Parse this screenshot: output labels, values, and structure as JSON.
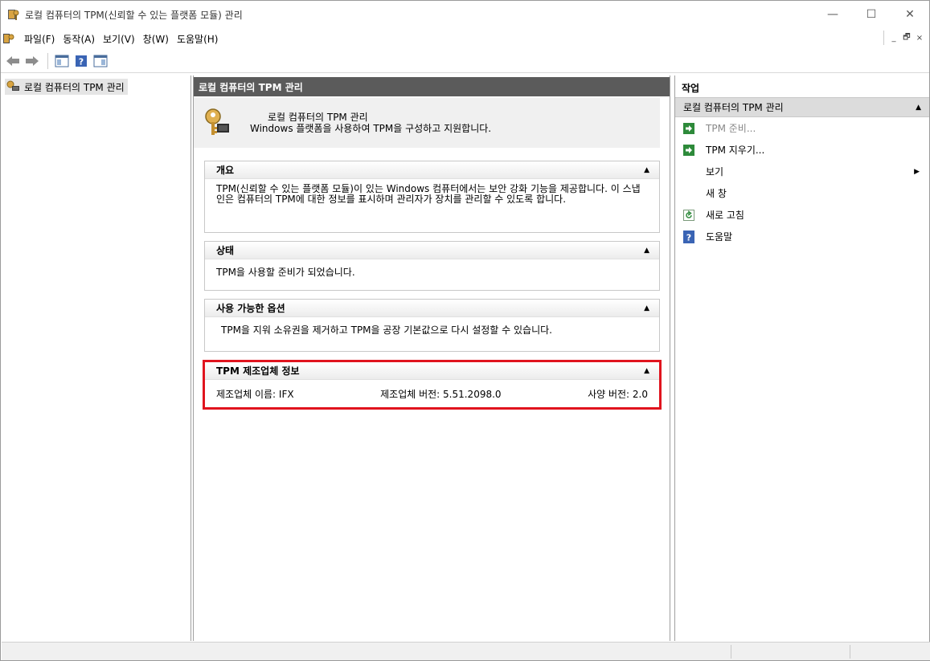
{
  "window": {
    "title": "로컬 컴퓨터의 TPM(신뢰할 수 있는 플랫폼 모듈) 관리",
    "controls": {
      "minimize": "—",
      "maximize": "☐",
      "close": "✕"
    }
  },
  "menubar": {
    "items": [
      "파일(F)",
      "동작(A)",
      "보기(V)",
      "창(W)",
      "도움말(H)"
    ],
    "mdi": {
      "minimize": "_",
      "restore": "🗗",
      "close": "×"
    }
  },
  "toolbar": {
    "buttons": [
      "back-icon",
      "forward-icon",
      "show-hide-console-tree-icon",
      "help-icon",
      "show-hide-action-pane-icon"
    ]
  },
  "tree": {
    "root_label": "로컬 컴퓨터의 TPM 관리"
  },
  "center": {
    "header": "로컬 컴퓨터의 TPM 관리",
    "intro": {
      "title": "로컬 컴퓨터의 TPM 관리",
      "subtitle": "Windows 플랫폼을 사용하여 TPM을 구성하고 지원합니다."
    },
    "sections": {
      "overview": {
        "title": "개요",
        "body": "TPM(신뢰할 수 있는 플랫폼 모듈)이 있는 Windows 컴퓨터에서는 보안 강화 기능을 제공합니다. 이 스냅인은 컴퓨터의 TPM에 대한 정보를 표시하며 관리자가 장치를 관리할 수 있도록 합니다."
      },
      "status": {
        "title": "상태",
        "body": "TPM을 사용할 준비가 되었습니다."
      },
      "options": {
        "title": "사용 가능한 옵션",
        "body": "TPM을 지워 소유권을 제거하고 TPM을 공장 기본값으로 다시 설정할 수 있습니다."
      },
      "manufacturer": {
        "title": "TPM 제조업체 정보",
        "name": "제조업체 이름: IFX",
        "version": "제조업체 버전: 5.51.2098.0",
        "spec": "사양 버전: 2.0",
        "highlight_color": "#e0141e"
      }
    }
  },
  "actions": {
    "title": "작업",
    "group": "로컬 컴퓨터의 TPM 관리",
    "items": [
      {
        "label": "TPM 준비...",
        "icon": "green-arrow-icon",
        "disabled": true
      },
      {
        "label": "TPM 지우기...",
        "icon": "green-arrow-icon",
        "disabled": false
      },
      {
        "label": "보기",
        "icon": "",
        "submenu": true
      },
      {
        "label": "새 창",
        "icon": ""
      },
      {
        "label": "새로 고침",
        "icon": "refresh-icon"
      },
      {
        "label": "도움말",
        "icon": "help-icon"
      }
    ]
  }
}
